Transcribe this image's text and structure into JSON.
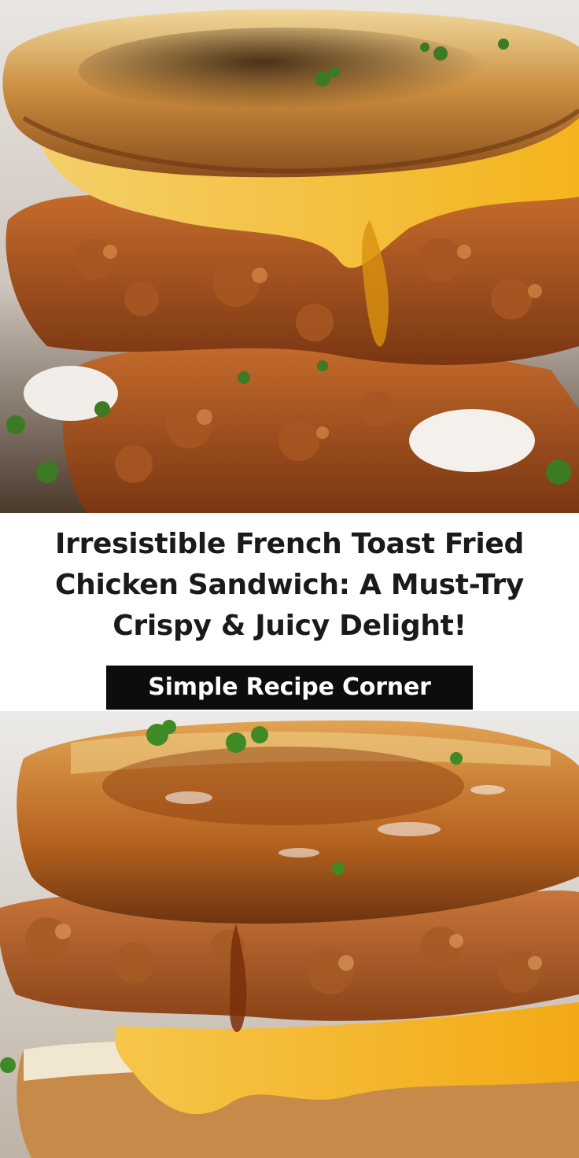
{
  "pin": {
    "title": "Irresistible French Toast Fried Chicken Sandwich: A Must-Try Crispy & Juicy Delight!",
    "brand": "Simple Recipe Corner"
  },
  "images": {
    "top": {
      "subject": "french toast fried chicken sandwich with melted cheese and syrup"
    },
    "bottom": {
      "subject": "french toast fried chicken sandwich glazed with syrup"
    }
  },
  "colors": {
    "title_text": "#1a1a1a",
    "badge_background": "#0d0d0d",
    "badge_text": "#ffffff"
  }
}
